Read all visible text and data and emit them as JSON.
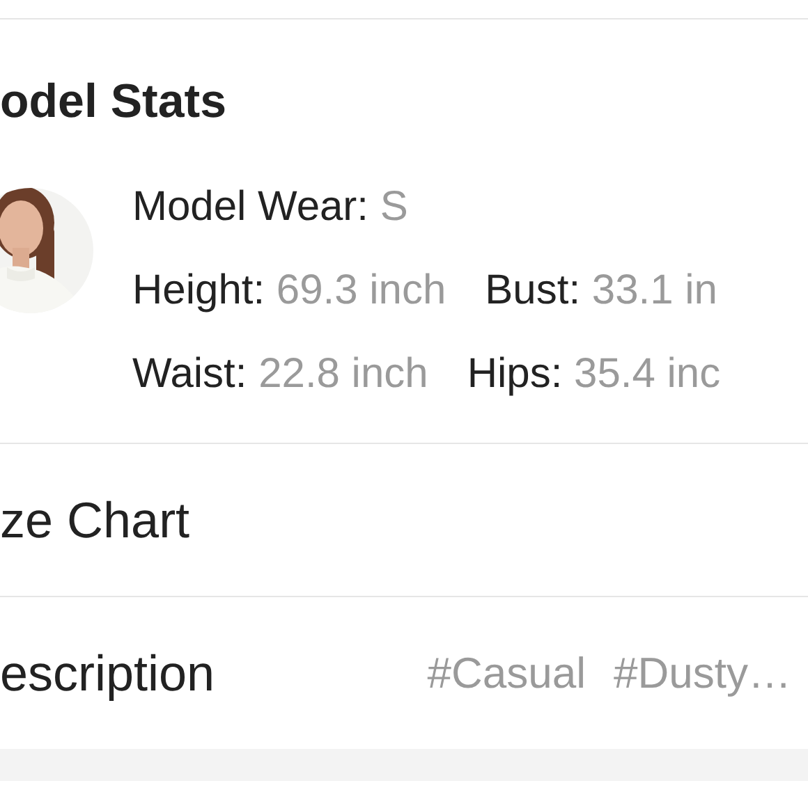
{
  "header": {
    "title": "odel Stats"
  },
  "model": {
    "stats": [
      [
        {
          "label": "Model Wear:",
          "value": "S"
        }
      ],
      [
        {
          "label": "Height:",
          "value": "69.3 inch"
        },
        {
          "label": "Bust:",
          "value": "33.1 in"
        }
      ],
      [
        {
          "label": "Waist:",
          "value": "22.8 inch"
        },
        {
          "label": "Hips:",
          "value": "35.4 inc"
        }
      ]
    ]
  },
  "sections": [
    {
      "title": "ze Chart"
    },
    {
      "title": "escription",
      "tags": [
        "#Casual",
        "#Dusty…"
      ]
    }
  ]
}
